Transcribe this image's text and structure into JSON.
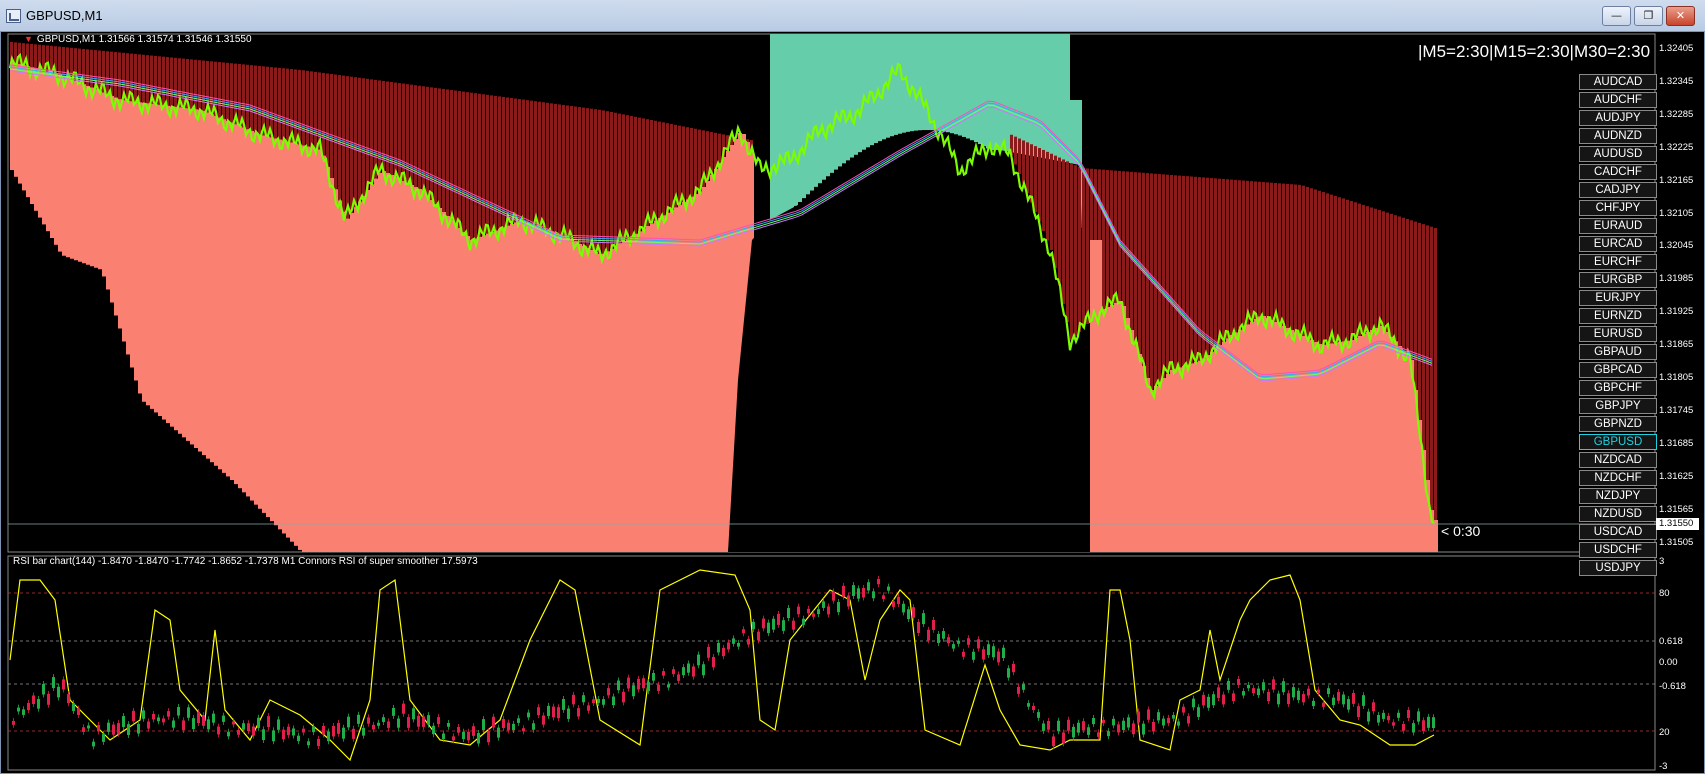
{
  "window": {
    "title": "GBPUSD,M1",
    "buttons": {
      "minimize": "—",
      "restore": "❐",
      "close": "✕"
    }
  },
  "chart": {
    "info_line": "GBPUSD,M1  1.31566 1.31574 1.31546 1.31550",
    "timeframes_label": "|M5=2:30|M15=2:30|M30=2:30",
    "countdown": "< 0:30",
    "current_price": "1.31550",
    "price_ticks": [
      "1.32405",
      "1.32345",
      "1.32285",
      "1.32225",
      "1.32165",
      "1.32105",
      "1.32045",
      "1.31985",
      "1.31925",
      "1.31865",
      "1.31805",
      "1.31745",
      "1.31685",
      "1.31625",
      "1.31565",
      "1.31505"
    ],
    "symbols": [
      "AUDCAD",
      "AUDCHF",
      "AUDJPY",
      "AUDNZD",
      "AUDUSD",
      "CADCHF",
      "CADJPY",
      "CHFJPY",
      "EURAUD",
      "EURCAD",
      "EURCHF",
      "EURGBP",
      "EURJPY",
      "EURNZD",
      "EURUSD",
      "GBPAUD",
      "GBPCAD",
      "GBPCHF",
      "GBPJPY",
      "GBPNZD",
      "GBPUSD",
      "NZDCAD",
      "NZDCHF",
      "NZDJPY",
      "NZDUSD",
      "USDCAD",
      "USDCHF",
      "USDJPY"
    ],
    "active_symbol": "GBPUSD",
    "colors": {
      "salmon": "#fa8072",
      "dark_red": "#8b1a1a",
      "teal": "#66cdaa",
      "green": "#7cfc00",
      "yellow": "#ffff00"
    }
  },
  "indicator": {
    "info_line": "RSI bar chart(144) -1.8470 -1.8470 -1.7742 -1.8652 -1.7378  M1 Connors RSI of super smoother 17.5973",
    "ticks": [
      "3",
      "80",
      "0.618",
      "0.00",
      "-0.618",
      "20",
      "-3"
    ]
  }
}
